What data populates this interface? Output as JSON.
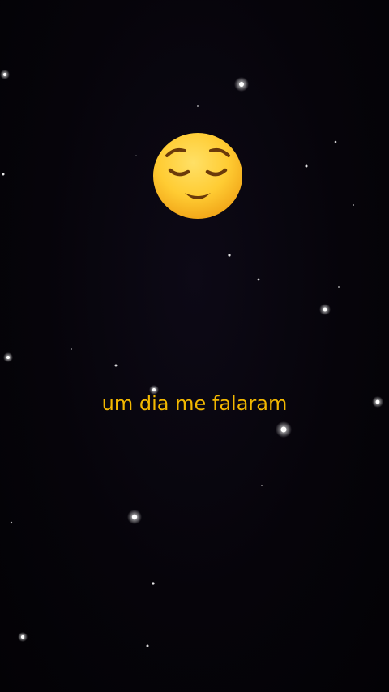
{
  "caption": {
    "text": "um dia me falaram",
    "color": "#f3b800"
  },
  "emoji": {
    "icon": "relieved-face-icon",
    "face_color": "#ffcc33",
    "feature_color": "#6b3a0a"
  },
  "background": {
    "color": "#050308",
    "star_color": "#ffffff"
  }
}
